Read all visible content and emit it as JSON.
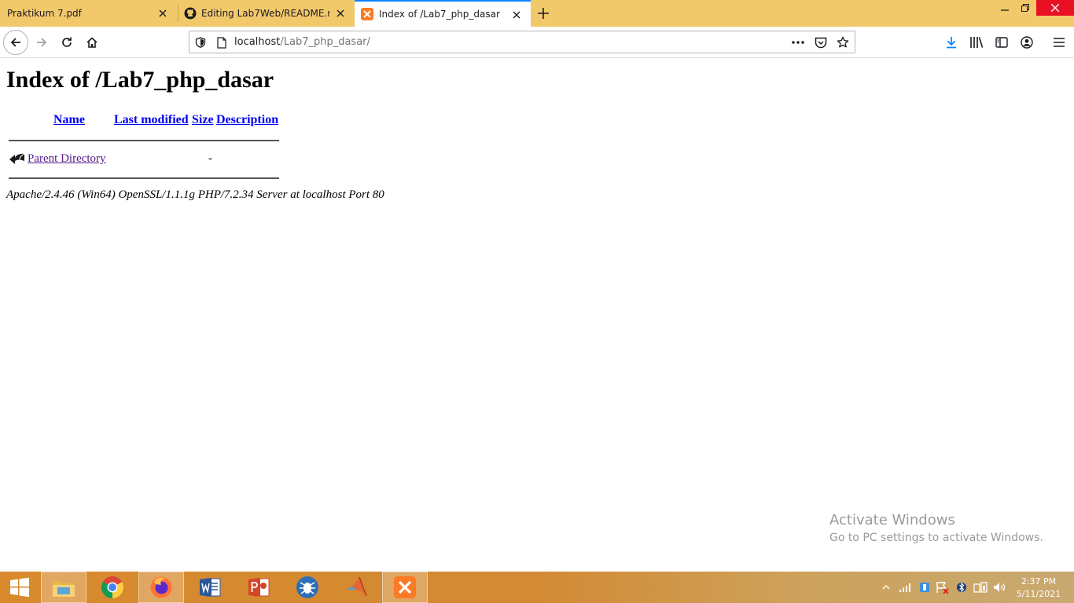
{
  "browser": {
    "tabs": [
      {
        "title": "Praktikum 7.pdf",
        "icon": "none",
        "active": false
      },
      {
        "title": "Editing Lab7Web/README.md",
        "icon": "github-icon",
        "active": false
      },
      {
        "title": "Index of /Lab7_php_dasar",
        "icon": "xampp-icon",
        "active": true
      }
    ],
    "url_host": "localhost",
    "url_path": "/Lab7_php_dasar/",
    "accent": "#0a84ff",
    "tabstrip_color": "#f2c96a"
  },
  "page": {
    "heading": "Index of /Lab7_php_dasar",
    "columns": {
      "name": "Name",
      "last_modified": "Last modified",
      "size": "Size",
      "description": "Description"
    },
    "rows": [
      {
        "name": "Parent Directory",
        "last_modified": "",
        "size": "-",
        "description": "",
        "icon": "back-arrow-icon"
      }
    ],
    "address": "Apache/2.4.46 (Win64) OpenSSL/1.1.1g PHP/7.2.34 Server at localhost Port 80"
  },
  "watermark": {
    "line1": "Activate Windows",
    "line2": "Go to PC settings to activate Windows."
  },
  "taskbar": {
    "apps": [
      "windows-start-icon",
      "file-explorer-icon",
      "chrome-icon",
      "firefox-icon",
      "word-icon",
      "powerpoint-icon",
      "burp-icon",
      "matlab-icon",
      "xampp-icon"
    ],
    "active": [
      "firefox-icon",
      "xampp-icon"
    ],
    "time": "2:37 PM",
    "date": "5/11/2021"
  }
}
